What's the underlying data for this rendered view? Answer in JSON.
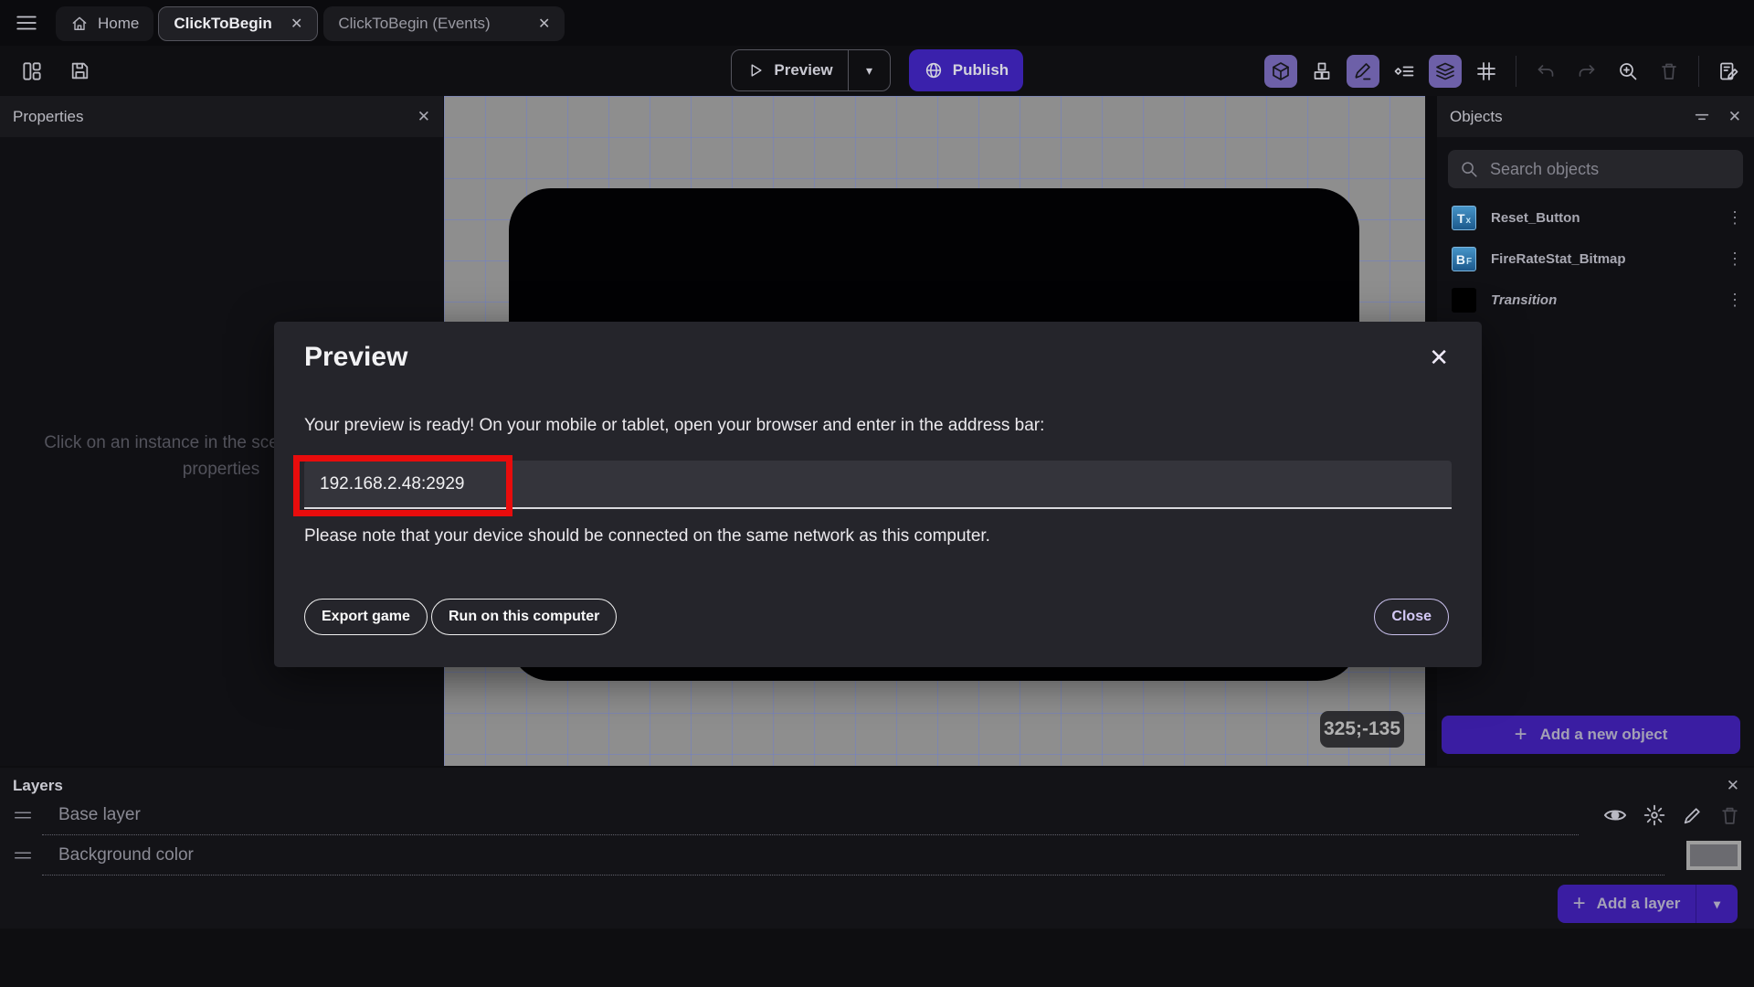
{
  "topbar": {
    "tabs": [
      {
        "label": "Home"
      },
      {
        "label": "ClickToBegin"
      },
      {
        "label": "ClickToBegin (Events)"
      }
    ]
  },
  "toolbar": {
    "preview_label": "Preview",
    "publish_label": "Publish"
  },
  "properties_panel": {
    "title": "Properties",
    "empty_text": "Click on an instance in the scene to display its properties"
  },
  "canvas": {
    "coordinates_badge": "325;-135"
  },
  "objects_panel": {
    "title": "Objects",
    "search_placeholder": "Search objects",
    "items": [
      {
        "label": "Reset_Button",
        "icon_main": "T",
        "icon_sub": "x"
      },
      {
        "label": "FireRateStat_Bitmap",
        "icon_main": "B",
        "icon_sub": "F"
      },
      {
        "label": "Transition",
        "icon_main": "",
        "icon_sub": ""
      }
    ],
    "add_button_label": "Add a new object"
  },
  "layers_panel": {
    "title": "Layers",
    "rows": [
      {
        "label": "Base layer"
      },
      {
        "label": "Background color"
      }
    ],
    "add_button_label": "Add a layer"
  },
  "modal": {
    "title": "Preview",
    "message": "Your preview is ready! On your mobile or tablet, open your browser and enter in the address bar:",
    "address_value": "192.168.2.48:2929",
    "note": "Please note that your device should be connected on the same network as this computer.",
    "buttons": {
      "export": "Export game",
      "run": "Run on this computer",
      "close": "Close"
    }
  },
  "icons": {
    "close": "✕",
    "kebab": "⋮",
    "caret_down": "▾",
    "plus": "+"
  },
  "colors": {
    "accent_purple": "#3a21ac",
    "toolbar_toggle_purple": "#6d60a8",
    "annotation_red": "#e80c0c",
    "canvas_gray": "#8e8e8e",
    "grid_blue": "#7080c8",
    "object_icon_blue": "#2e7fb5"
  }
}
